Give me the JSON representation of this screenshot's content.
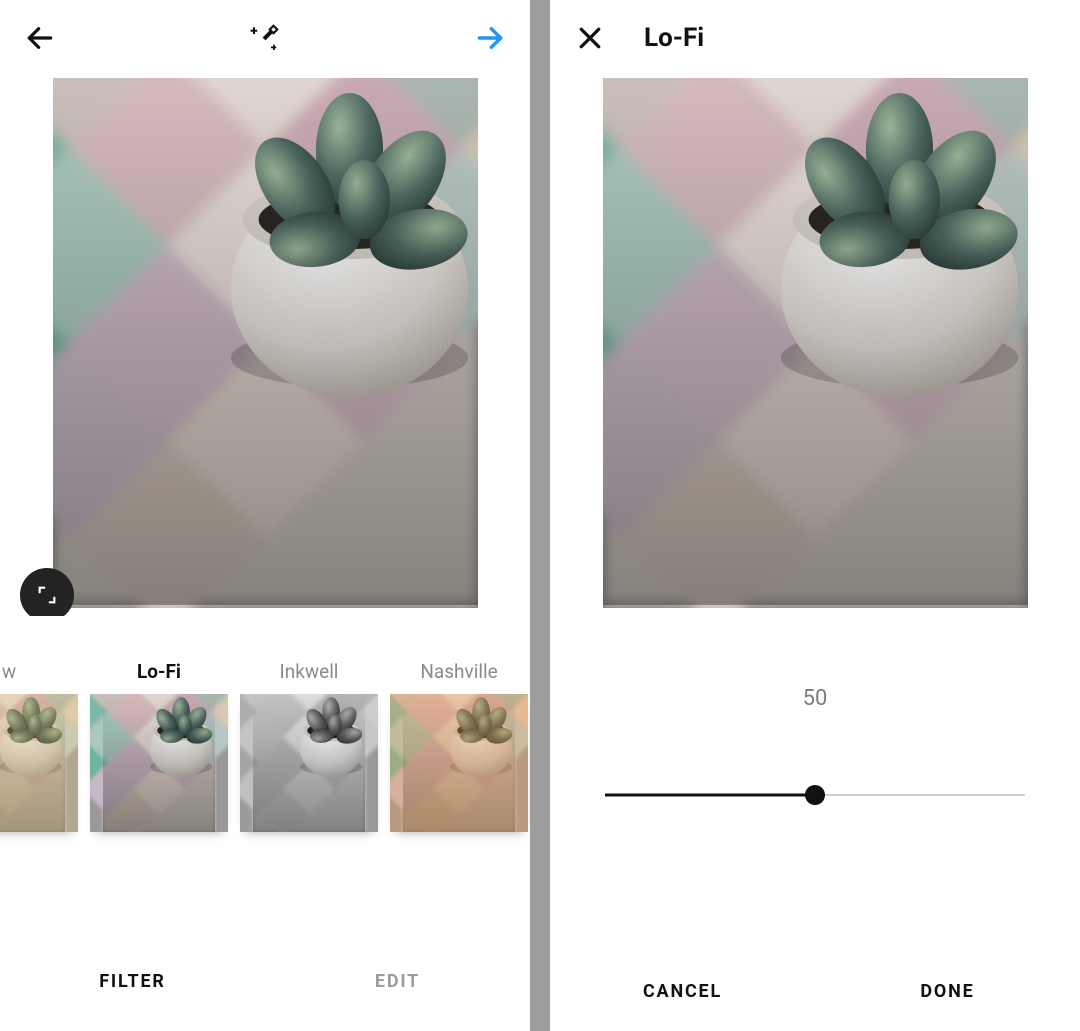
{
  "left": {
    "tabs": {
      "filter": "FILTER",
      "edit": "EDIT",
      "active": "filter"
    },
    "filters": [
      {
        "name": "w",
        "active": false,
        "tint": "rgba(255,210,120,0.25)"
      },
      {
        "name": "Lo-Fi",
        "active": true,
        "tint": "rgba(0,0,0,0)"
      },
      {
        "name": "Inkwell",
        "active": false,
        "tint": "grayscale"
      },
      {
        "name": "Nashville",
        "active": false,
        "tint": "rgba(255,160,70,0.30)"
      }
    ]
  },
  "right": {
    "title": "Lo-Fi",
    "slider": {
      "value": 50,
      "min": 0,
      "max": 100
    },
    "actions": {
      "cancel": "CANCEL",
      "done": "DONE"
    }
  },
  "colors": {
    "accent": "#2196f3"
  }
}
